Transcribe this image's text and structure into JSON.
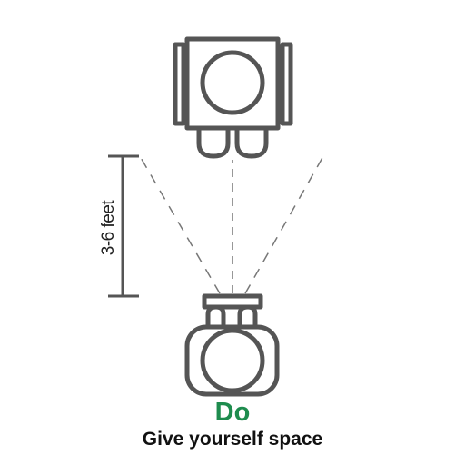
{
  "distance_label": "3-6 feet",
  "verdict": "Do",
  "caption": "Give yourself space",
  "colors": {
    "stroke": "#555555",
    "verdict": "#1e8c4e",
    "text": "#111111"
  }
}
